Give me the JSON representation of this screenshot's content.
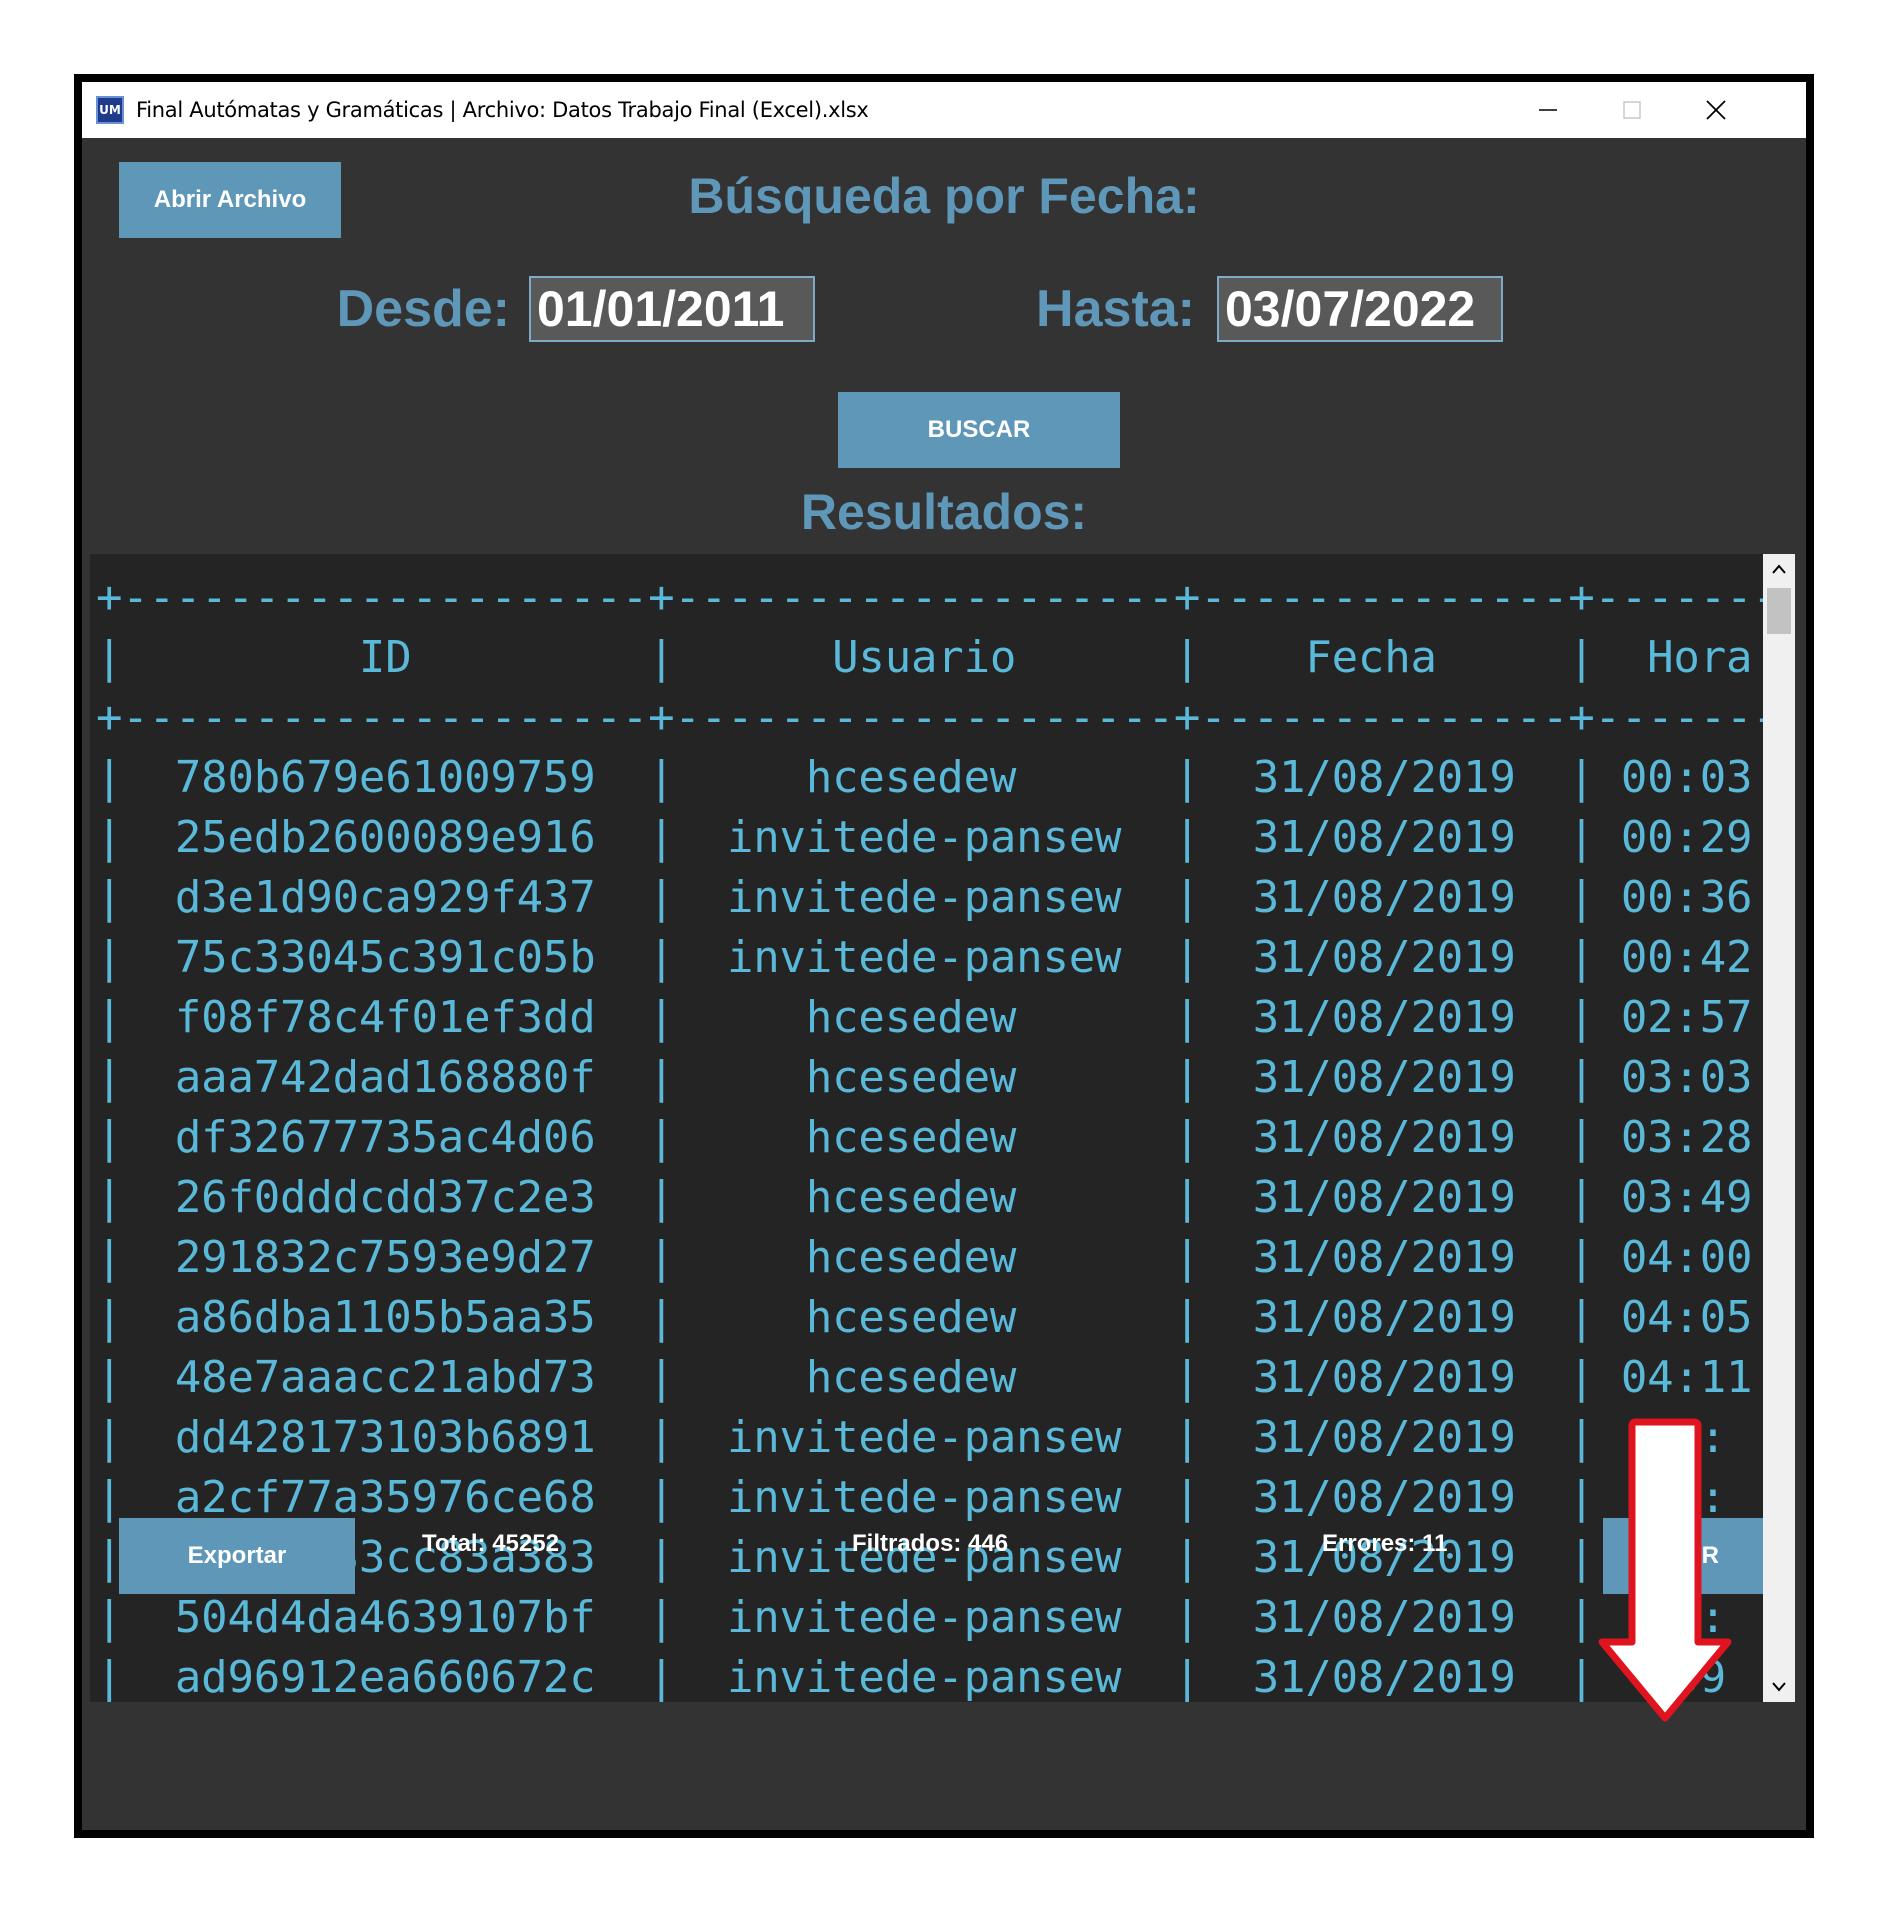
{
  "window": {
    "icon_label": "UM",
    "title": "Final Autómatas y Gramáticas | Archivo: Datos Trabajo Final (Excel).xlsx"
  },
  "toolbar": {
    "open_file_label": "Abrir Archivo",
    "search_title": "Búsqueda por Fecha:",
    "from_label": "Desde:",
    "from_value": "01/01/2011",
    "to_label": "Hasta:",
    "to_value": "03/07/2022",
    "search_button_label": "BUSCAR",
    "results_title": "Resultados:"
  },
  "table": {
    "columns": [
      "ID",
      "Usuario",
      "Fecha",
      "Hora"
    ],
    "rows": [
      {
        "id": "780b679e61009759",
        "usuario": "hcesedew",
        "fecha": "31/08/2019",
        "hora": "00:03"
      },
      {
        "id": "25edb2600089e916",
        "usuario": "invitede-pansew",
        "fecha": "31/08/2019",
        "hora": "00:29"
      },
      {
        "id": "d3e1d90ca929f437",
        "usuario": "invitede-pansew",
        "fecha": "31/08/2019",
        "hora": "00:36"
      },
      {
        "id": "75c33045c391c05b",
        "usuario": "invitede-pansew",
        "fecha": "31/08/2019",
        "hora": "00:42"
      },
      {
        "id": "f08f78c4f01ef3dd",
        "usuario": "hcesedew",
        "fecha": "31/08/2019",
        "hora": "02:57"
      },
      {
        "id": "aaa742dad168880f",
        "usuario": "hcesedew",
        "fecha": "31/08/2019",
        "hora": "03:03"
      },
      {
        "id": "df32677735ac4d06",
        "usuario": "hcesedew",
        "fecha": "31/08/2019",
        "hora": "03:28"
      },
      {
        "id": "26f0dddcdd37c2e3",
        "usuario": "hcesedew",
        "fecha": "31/08/2019",
        "hora": "03:49"
      },
      {
        "id": "291832c7593e9d27",
        "usuario": "hcesedew",
        "fecha": "31/08/2019",
        "hora": "04:00"
      },
      {
        "id": "a86dba1105b5aa35",
        "usuario": "hcesedew",
        "fecha": "31/08/2019",
        "hora": "04:05"
      },
      {
        "id": "48e7aaacc21abd73",
        "usuario": "hcesedew",
        "fecha": "31/08/2019",
        "hora": "04:11"
      },
      {
        "id": "dd428173103b6891",
        "usuario": "invitede-pansew",
        "fecha": "31/08/2019",
        "hora": "08:"
      },
      {
        "id": "a2cf77a35976ce68",
        "usuario": "invitede-pansew",
        "fecha": "31/08/2019",
        "hora": "08:"
      },
      {
        "id": "5cfbec33cc83a383",
        "usuario": "invitede-pansew",
        "fecha": "31/08/2019",
        "hora": "08:"
      },
      {
        "id": "504d4da4639107bf",
        "usuario": "invitede-pansew",
        "fecha": "31/08/2019",
        "hora": "09:"
      },
      {
        "id": "ad96912ea660672c",
        "usuario": "invitede-pansew",
        "fecha": "31/08/2019",
        "hora": "09"
      }
    ]
  },
  "footer": {
    "export_label": "Exportar",
    "total_text": "Total: 45252",
    "filtered_text": "Filtrados: 446",
    "errors_text": "Errores: 11",
    "exit_label": "SALIR"
  },
  "icons": {
    "minimize": "minimize-icon",
    "maximize": "maximize-icon",
    "close": "close-icon",
    "scroll_up": "chevron-up-icon",
    "scroll_down": "chevron-down-icon",
    "annotation": "down-arrow-annotation-icon"
  },
  "colors": {
    "accent": "#5f97b8",
    "background": "#333333",
    "table_bg": "#242424",
    "table_text": "#5ab8d8",
    "annotation": "#e0141e"
  }
}
